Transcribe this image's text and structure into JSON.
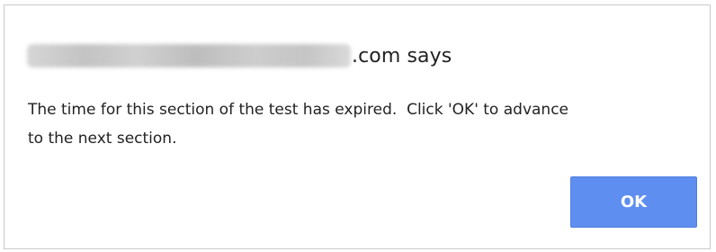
{
  "dialog": {
    "title_suffix": ".com says",
    "message": "The time for this section of the test has expired.  Click 'OK' to advance\nto the next section.",
    "ok_label": "OK"
  },
  "colors": {
    "button_bg": "#5e8ef0",
    "button_text": "#ffffff",
    "text": "#222222",
    "border": "#c9c9c9"
  }
}
